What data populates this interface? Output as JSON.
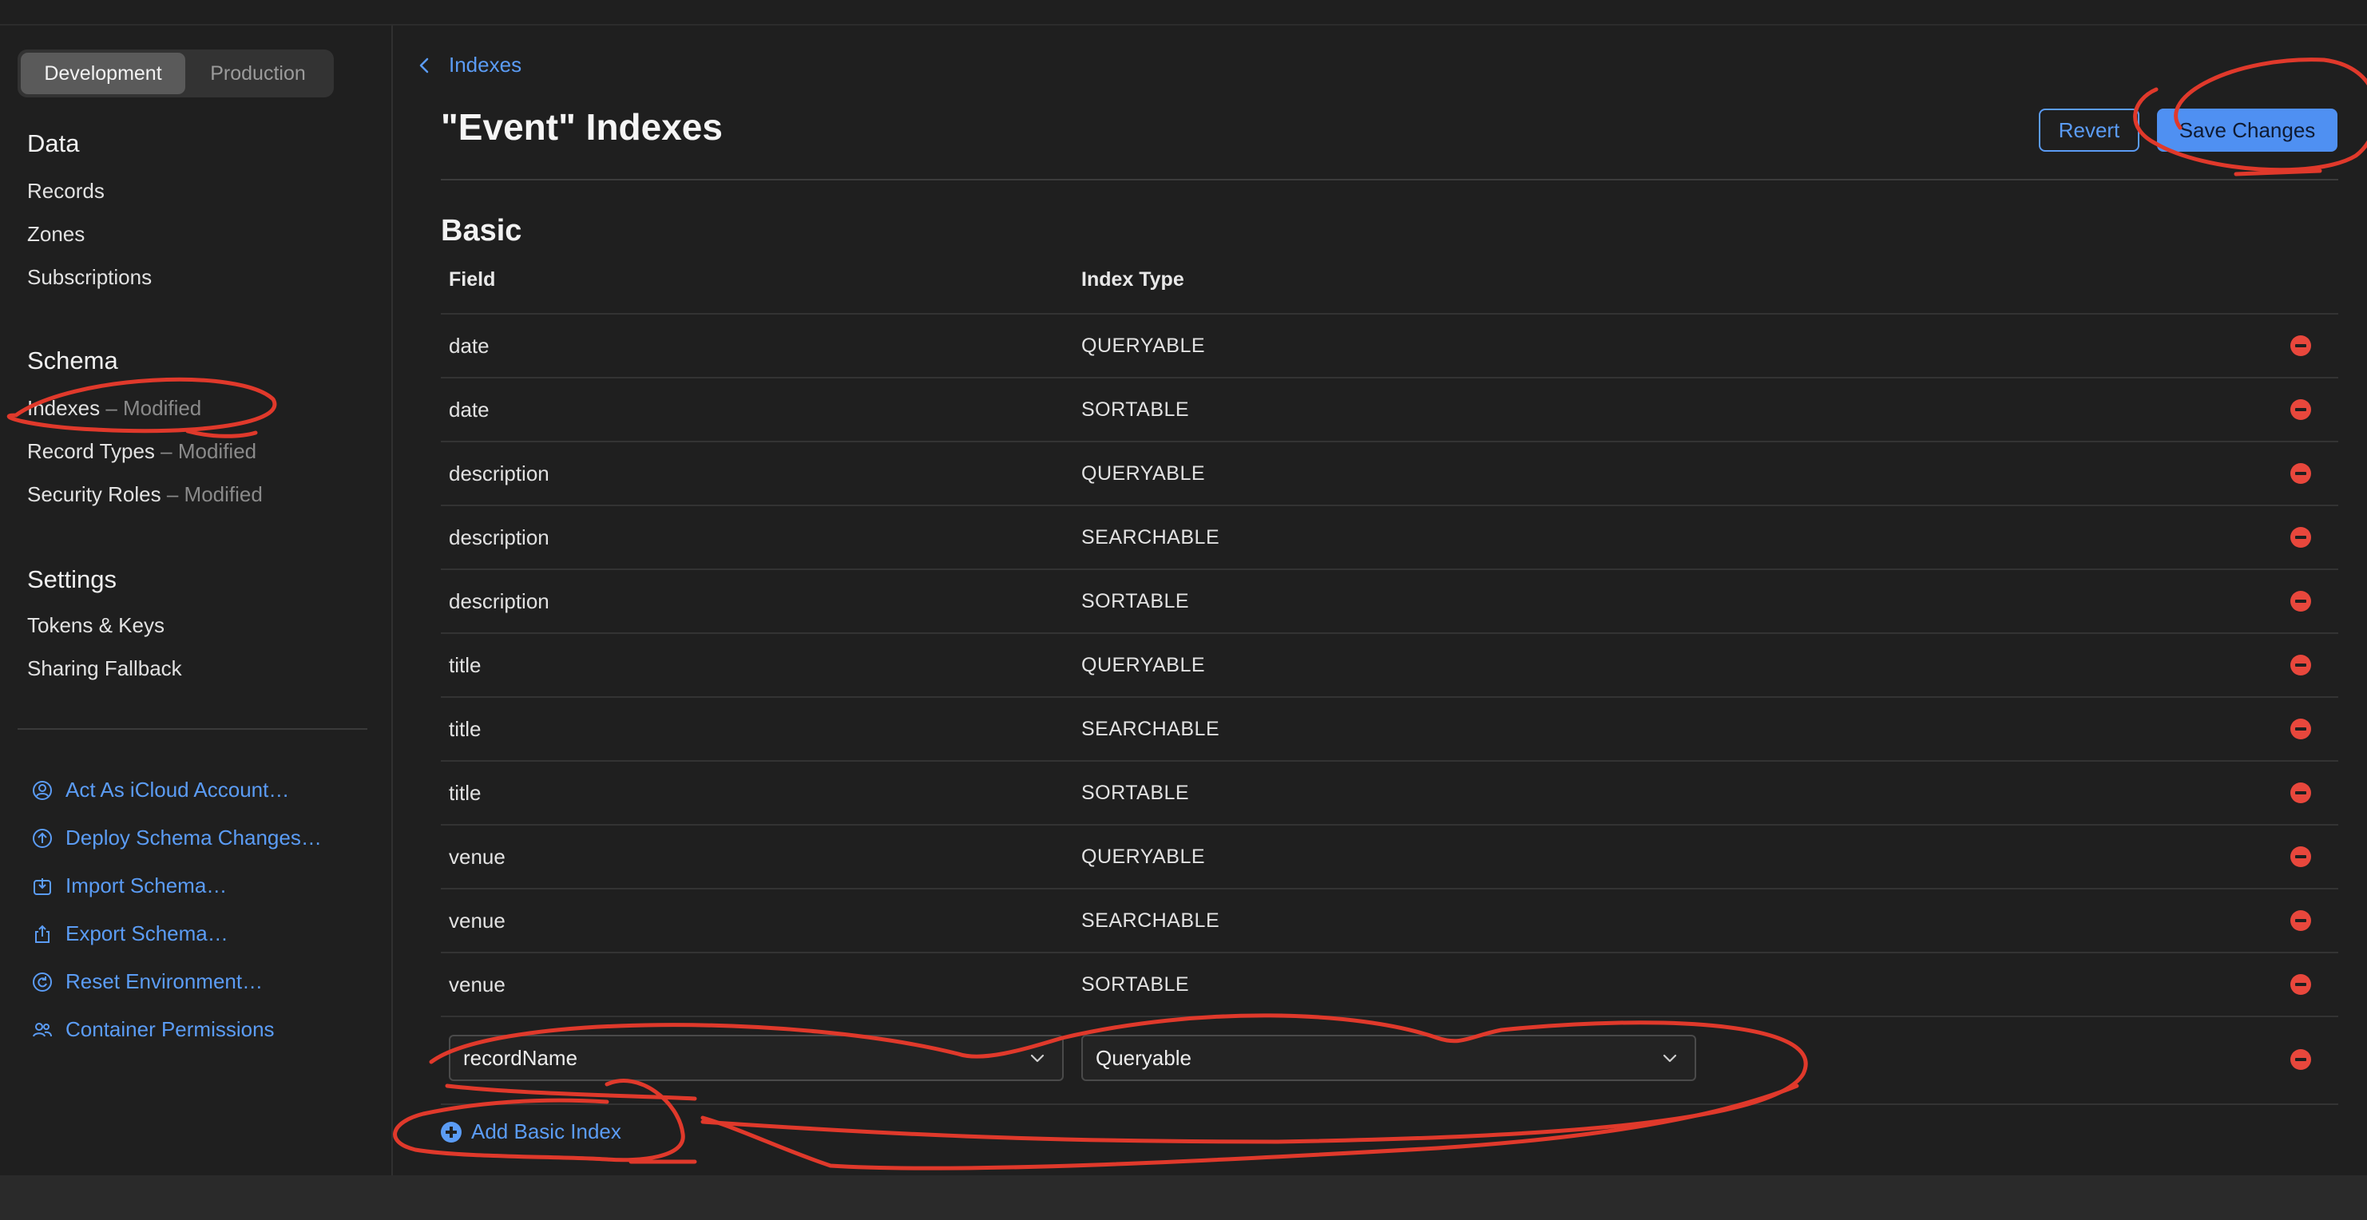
{
  "environment_toggle": {
    "options": [
      "Development",
      "Production"
    ],
    "selected": "Development"
  },
  "sidebar": {
    "data_title": "Data",
    "data_items": [
      "Records",
      "Zones",
      "Subscriptions"
    ],
    "schema_title": "Schema",
    "schema_items": [
      {
        "label": "Indexes",
        "status": "– Modified"
      },
      {
        "label": "Record Types",
        "status": "– Modified"
      },
      {
        "label": "Security Roles",
        "status": "– Modified"
      }
    ],
    "settings_title": "Settings",
    "settings_items": [
      "Tokens & Keys",
      "Sharing Fallback"
    ],
    "actions": [
      {
        "label": "Act As iCloud Account…",
        "icon": "person-circle-icon"
      },
      {
        "label": "Deploy Schema Changes…",
        "icon": "arrow-up-circle-icon"
      },
      {
        "label": "Import Schema…",
        "icon": "tray-arrow-down-icon"
      },
      {
        "label": "Export Schema…",
        "icon": "share-icon"
      },
      {
        "label": "Reset Environment…",
        "icon": "reset-circle-icon"
      },
      {
        "label": "Container Permissions",
        "icon": "people-icon"
      }
    ]
  },
  "breadcrumb": {
    "label": "Indexes"
  },
  "page": {
    "title": "\"Event\" Indexes",
    "revert_label": "Revert",
    "save_label": "Save Changes",
    "section_title": "Basic",
    "columns": {
      "field": "Field",
      "type": "Index Type"
    }
  },
  "indexes": [
    {
      "field": "date",
      "type": "QUERYABLE"
    },
    {
      "field": "date",
      "type": "SORTABLE"
    },
    {
      "field": "description",
      "type": "QUERYABLE"
    },
    {
      "field": "description",
      "type": "SEARCHABLE"
    },
    {
      "field": "description",
      "type": "SORTABLE"
    },
    {
      "field": "title",
      "type": "QUERYABLE"
    },
    {
      "field": "title",
      "type": "SEARCHABLE"
    },
    {
      "field": "title",
      "type": "SORTABLE"
    },
    {
      "field": "venue",
      "type": "QUERYABLE"
    },
    {
      "field": "venue",
      "type": "SEARCHABLE"
    },
    {
      "field": "venue",
      "type": "SORTABLE"
    }
  ],
  "new_index": {
    "field_value": "recordName",
    "type_value": "Queryable"
  },
  "add_index_label": "Add Basic Index",
  "colors": {
    "accent": "#5b9cf5",
    "destructive": "#e8473c",
    "annotation": "#e0392b",
    "background": "#1f1f1f"
  }
}
